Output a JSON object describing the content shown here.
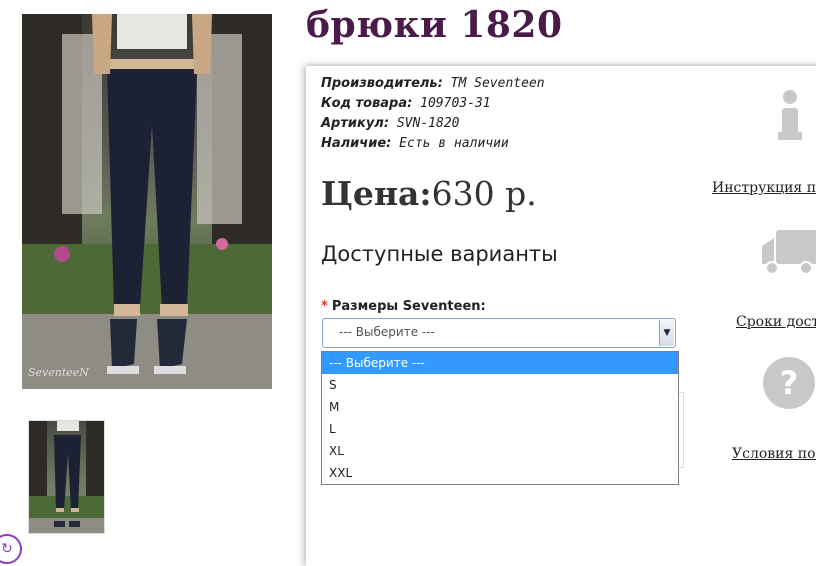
{
  "product": {
    "title": "брюки 1820",
    "specs": [
      {
        "label": "Производитель:",
        "value": "ТМ Seventeen"
      },
      {
        "label": "Код товара:",
        "value": "109703-31"
      },
      {
        "label": "Артикул:",
        "value": "SVN-1820"
      },
      {
        "label": "Наличие:",
        "value": "Есть в наличии"
      }
    ],
    "price_label": "Цена:",
    "price_value": "630 р.",
    "variants_title": "Доступные варианты",
    "size_label": "Размеры Seventeen:",
    "required_mark": "*"
  },
  "select": {
    "value": "--- Выберите ---",
    "options": [
      "--- Выберите ---",
      "S",
      "M",
      "L",
      "XL",
      "XXL"
    ],
    "selected_index": 0
  },
  "side": {
    "links": [
      "Инструкция по з",
      "Сроки достав",
      "Условия пок"
    ],
    "icons": [
      "info-icon",
      "truck-icon",
      "question-icon"
    ]
  },
  "photo_watermark": "SeventeeN"
}
